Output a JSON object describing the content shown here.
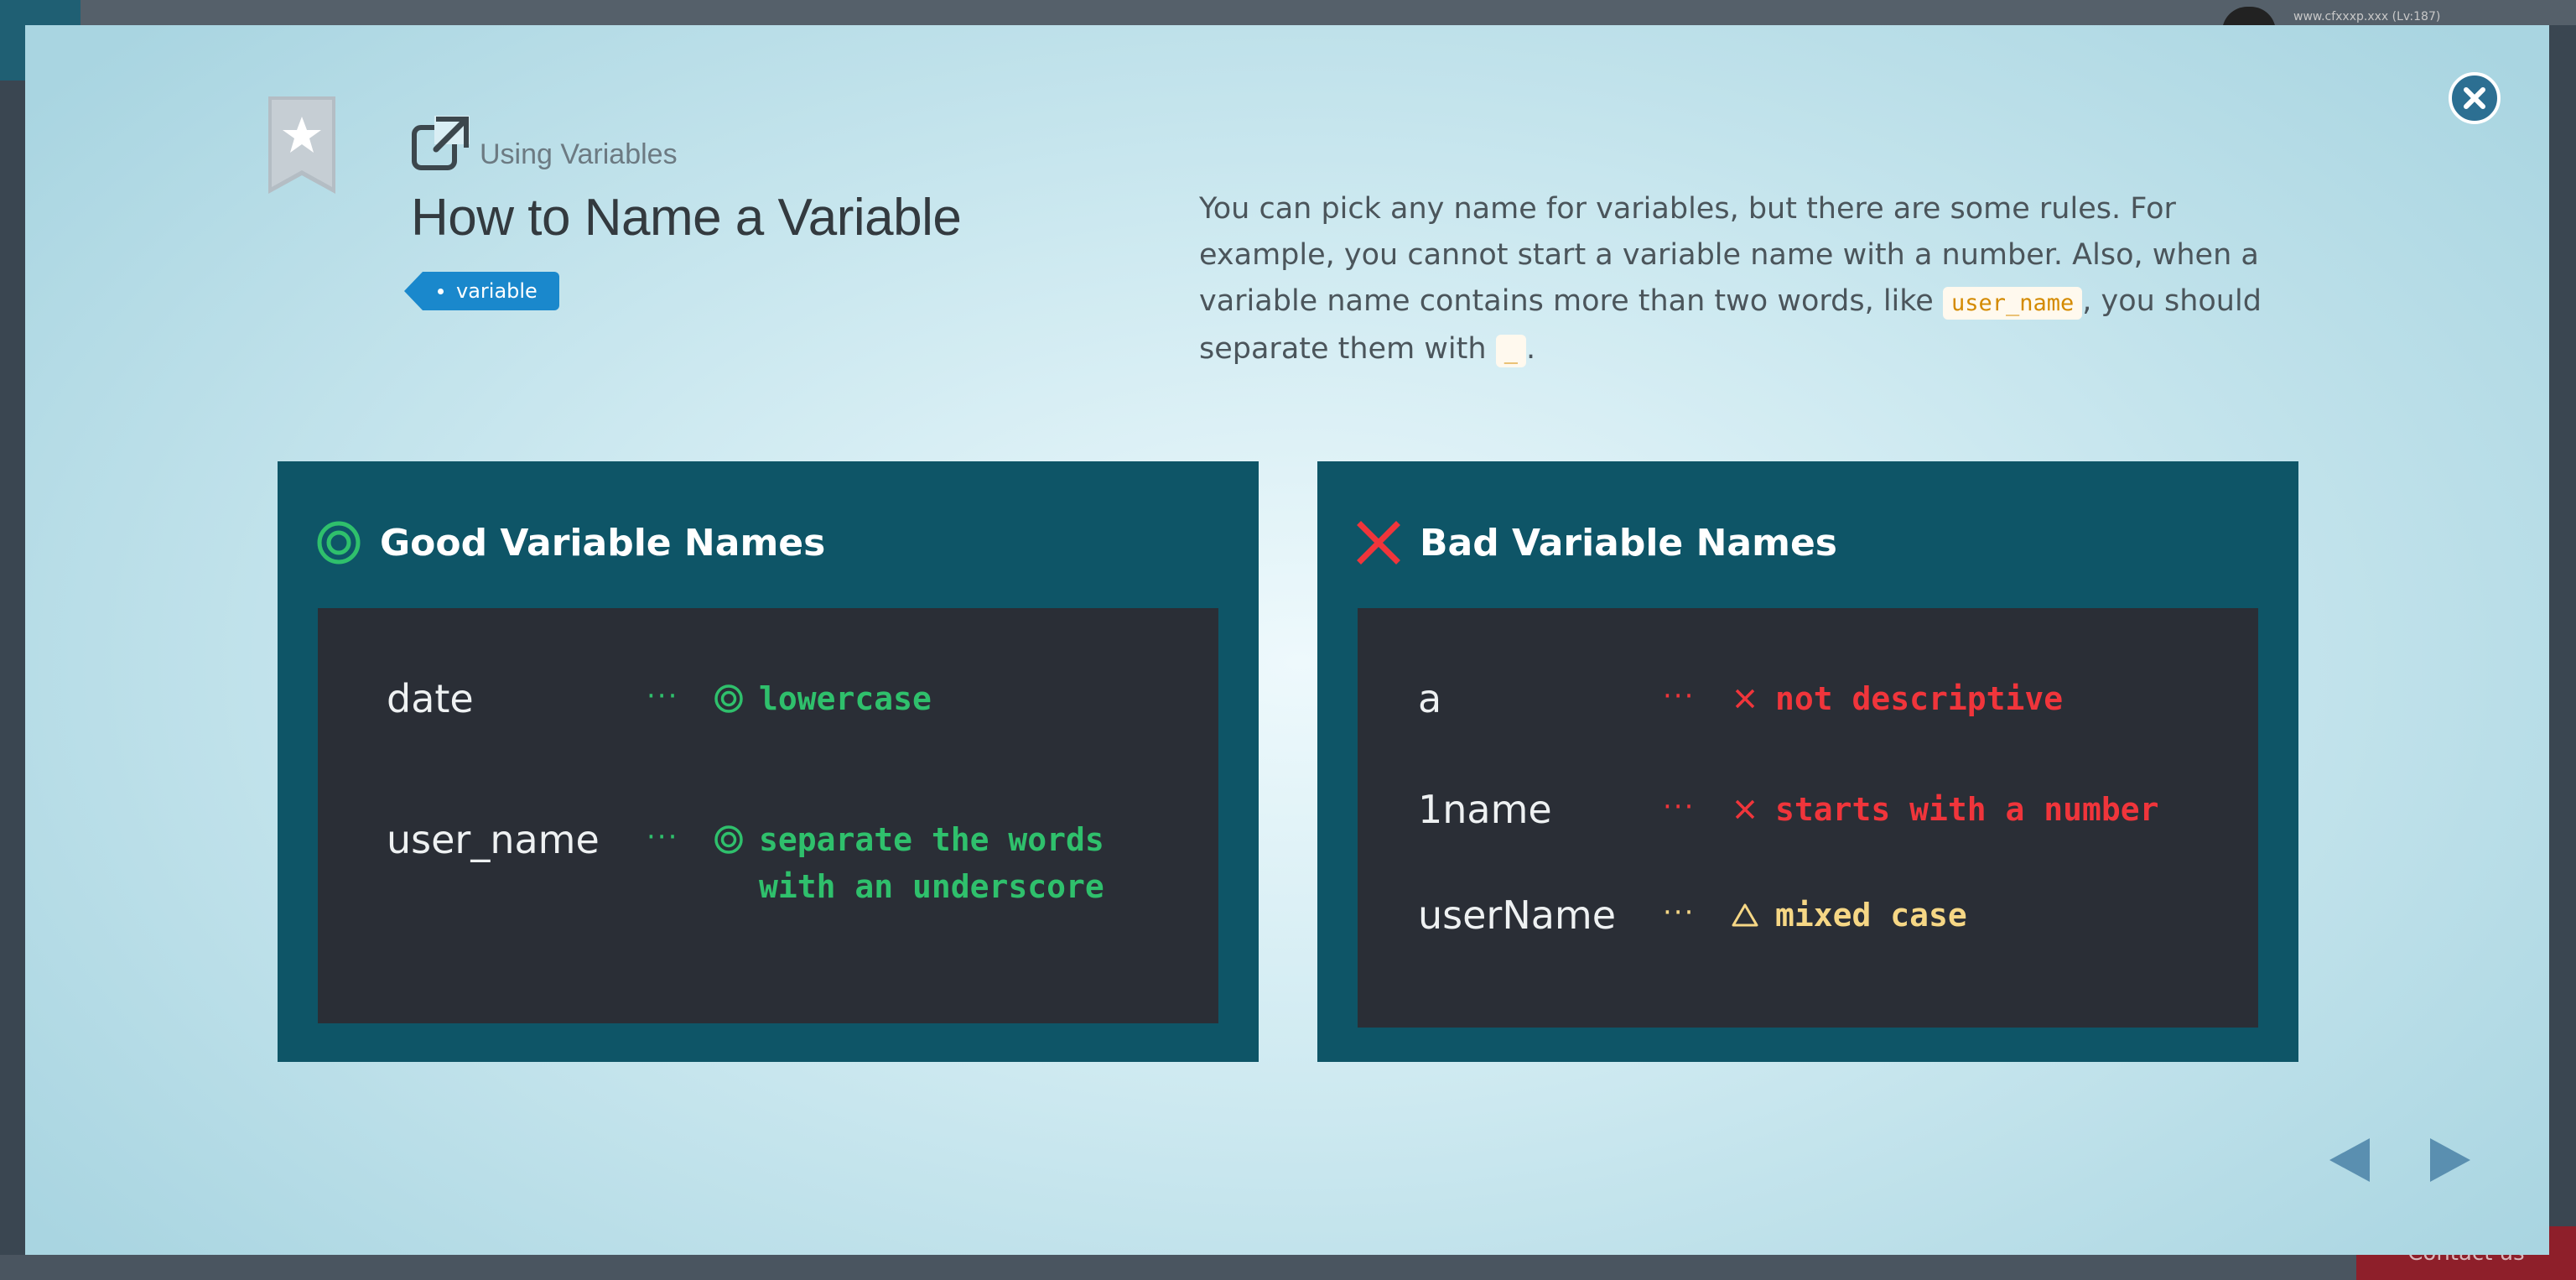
{
  "background": {
    "url_text": "www.cfxxxp.xxx (Lv:187)",
    "contact_label": "Contact us"
  },
  "lesson": {
    "breadcrumb": "Using Variables",
    "title": "How to Name a Variable",
    "tag": "variable",
    "description": {
      "part1": "You can pick any name for variables, but there are some rules. For example, you cannot start a variable name with a number. Also, when a variable name contains more than two words, like ",
      "code1": "user_name",
      "part2": ", you should separate them with ",
      "code2": "_",
      "part3": "."
    }
  },
  "good_panel": {
    "title": "Good Variable Names",
    "icon": "double-circle-icon",
    "color": "#2fc06c",
    "rows": [
      {
        "name": "date",
        "dots": "···",
        "reason_line1": "lowercase",
        "reason_line2": ""
      },
      {
        "name": "user_name",
        "dots": "···",
        "reason_line1": "separate the words",
        "reason_line2": "with an underscore"
      }
    ]
  },
  "bad_panel": {
    "title": "Bad Variable Names",
    "icon": "cross-icon",
    "color": "#f0353b",
    "warn_color": "#f6d785",
    "rows": [
      {
        "name": "a",
        "dots": "···",
        "reason": "not descriptive",
        "icon": "cross-icon"
      },
      {
        "name": "1name",
        "dots": "···",
        "reason": "starts with a number",
        "icon": "cross-icon"
      },
      {
        "name": "userName",
        "dots": "···",
        "reason": "mixed case",
        "icon": "triangle-icon"
      }
    ]
  },
  "colors": {
    "panel_bg": "#0e5567",
    "panel_body_bg": "#2a2e36",
    "tag_bg": "#1a88cc",
    "close_bg": "#2c6f92",
    "nav_arrow": "#5a8fb0"
  }
}
